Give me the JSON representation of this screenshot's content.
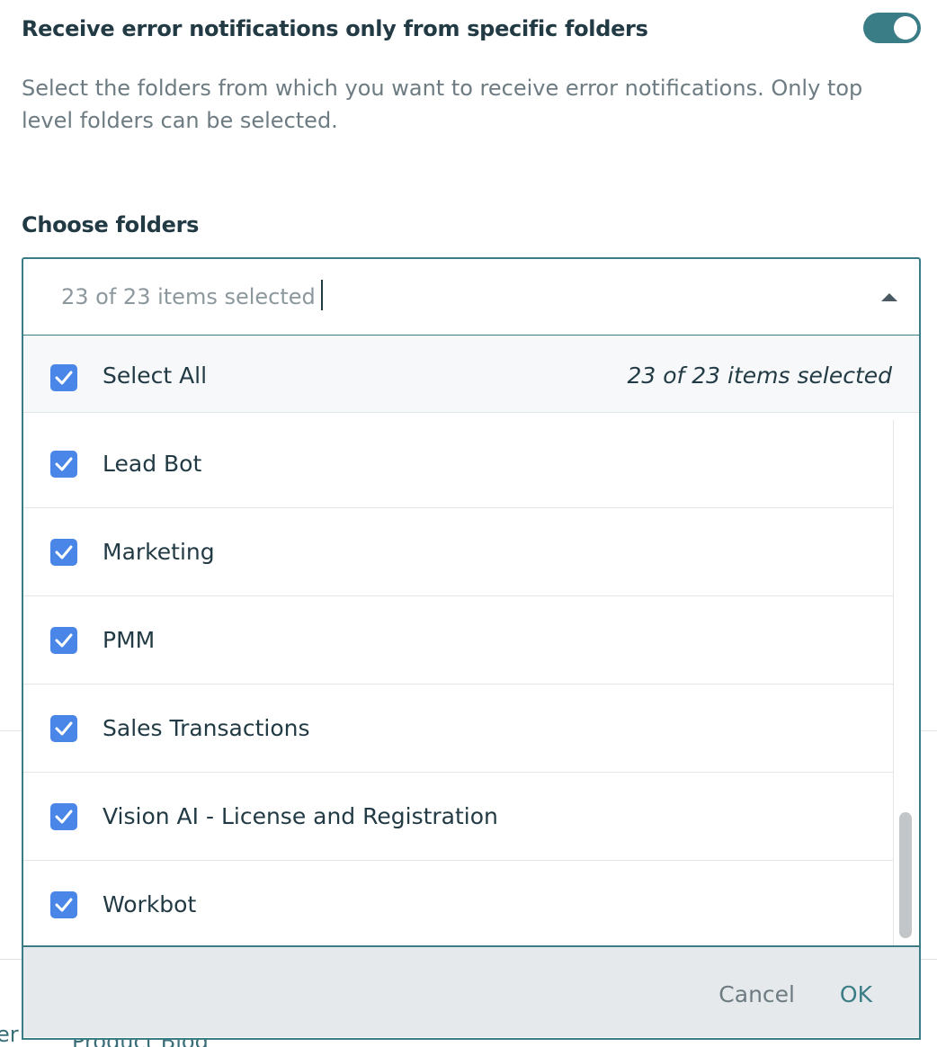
{
  "setting": {
    "title": "Receive error notifications only from specific folders",
    "toggle_on": true,
    "description": "Select the folders from which you want to receive error notifications. Only top level folders can be selected."
  },
  "chooser": {
    "label": "Choose folders",
    "value": "23 of 23 items selected",
    "select_all_label": "Select All",
    "select_all_checked": true,
    "selected_count": "23 of 23 items selected",
    "items": [
      {
        "label": "Lead Bot",
        "checked": true
      },
      {
        "label": "Marketing",
        "checked": true
      },
      {
        "label": "PMM",
        "checked": true
      },
      {
        "label": "Sales Transactions",
        "checked": true
      },
      {
        "label": "Vision AI - License and Registration",
        "checked": true
      },
      {
        "label": "Workbot",
        "checked": true
      }
    ],
    "cancel_label": "Cancel",
    "ok_label": "OK"
  },
  "background": {
    "footer_fragment_left": "er",
    "footer_fragment_blog": "Product Blog"
  },
  "colors": {
    "accent": "#3a7d86",
    "checkbox": "#4a86e8"
  }
}
